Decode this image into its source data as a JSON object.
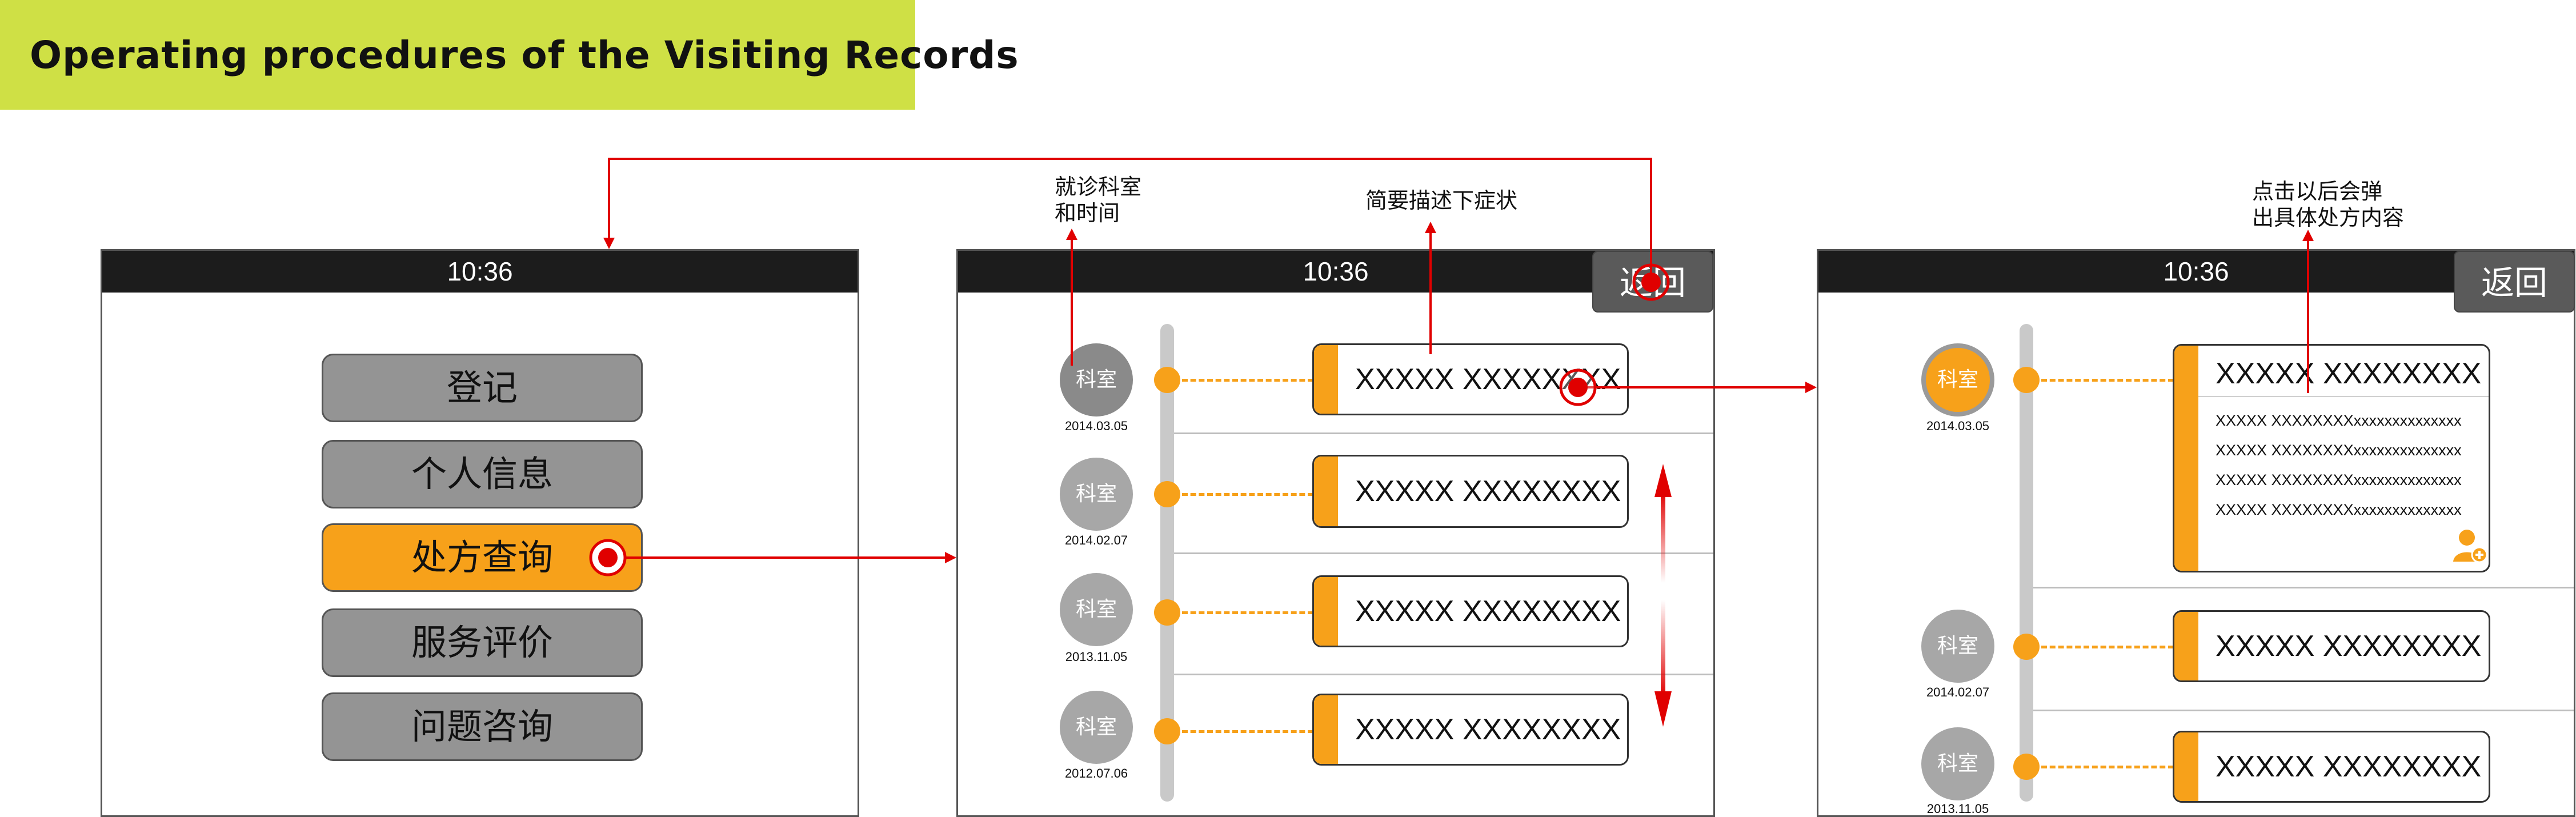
{
  "banner": {
    "title": "Operating procedures of the Visiting Records"
  },
  "screen1": {
    "time": "10:36",
    "menu": [
      "登记",
      "个人信息",
      "处方查询",
      "服务评价",
      "问题咨询"
    ],
    "active_index": 2
  },
  "screen2": {
    "time": "10:36",
    "back_label": "返回",
    "annotations": {
      "dept_time": [
        "就诊科室",
        "和时间"
      ],
      "symptoms": "简要描述下症状"
    },
    "records": [
      {
        "dept": "科室",
        "date": "2014.03.05",
        "summary": "XXXXX XXXXXXXX"
      },
      {
        "dept": "科室",
        "date": "2014.02.07",
        "summary": "XXXXX XXXXXXXX"
      },
      {
        "dept": "科室",
        "date": "2013.11.05",
        "summary": "XXXXX XXXXXXXX"
      },
      {
        "dept": "科室",
        "date": "2012.07.06",
        "summary": "XXXXX XXXXXXXX"
      }
    ]
  },
  "screen3": {
    "time": "10:36",
    "back_label": "返回",
    "annotation": [
      "点击以后会弹",
      "出具体处方内容"
    ],
    "expanded": {
      "dept": "科室",
      "date": "2014.03.05",
      "summary": "XXXXX XXXXXXXX",
      "details": [
        "XXXXX XXXXXXXXxxxxxxxxxxxxxx",
        "XXXXX XXXXXXXXxxxxxxxxxxxxxx",
        "XXXXX XXXXXXXXxxxxxxxxxxxxxx",
        "XXXXX XXXXXXXXxxxxxxxxxxxxxx"
      ]
    },
    "records": [
      {
        "dept": "科室",
        "date": "2014.02.07",
        "summary": "XXXXX XXXXXXXX"
      },
      {
        "dept": "科室",
        "date": "2013.11.05",
        "summary": "XXXXX XXXXXXXX"
      }
    ]
  },
  "colors": {
    "accent": "#f7a11a",
    "flow_arrow": "#e00000",
    "banner": "#cfe045",
    "status_bar": "#1c1c1c"
  },
  "icons": [
    "add-user-icon",
    "tap-target-icon",
    "scroll-arrow-icon"
  ]
}
